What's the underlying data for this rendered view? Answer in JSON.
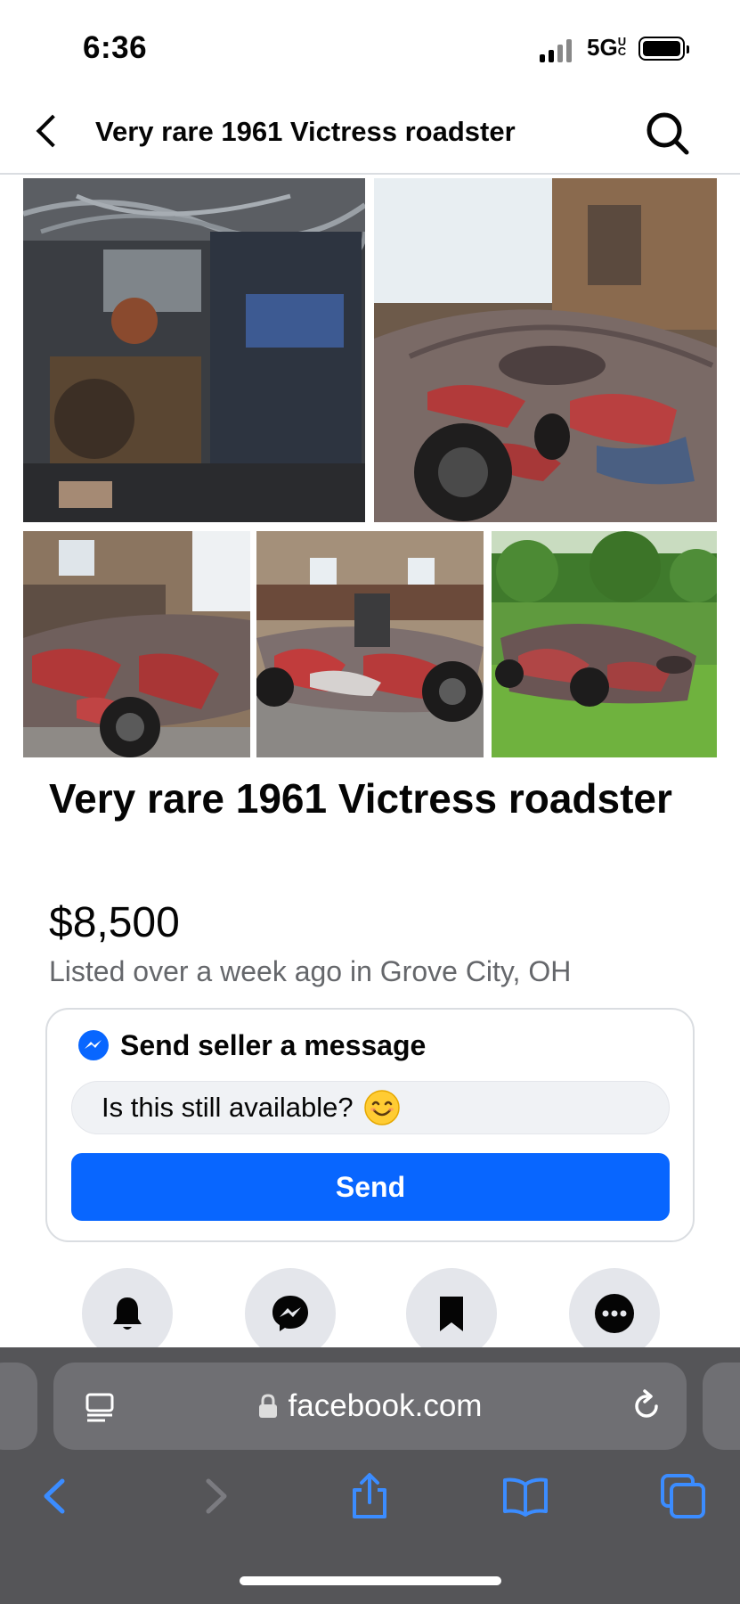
{
  "status_bar": {
    "time": "6:36",
    "network": "5G",
    "network_badge": "UC"
  },
  "header": {
    "title": "Very rare 1961 Victress roadster",
    "back_icon": "chevron-left-icon",
    "search_icon": "search-icon"
  },
  "photos": [
    {
      "subject": "engine-bay"
    },
    {
      "subject": "roadster-hood-in-garage"
    },
    {
      "subject": "roadster-side-in-garage"
    },
    {
      "subject": "roadster-front-in-garage"
    },
    {
      "subject": "roadster-on-grass"
    }
  ],
  "listing": {
    "title": "Very rare 1961 Victress roadster",
    "price": "$8,500",
    "listed": "Listed over a week ago in Grove City, OH"
  },
  "message": {
    "title": "Send seller a message",
    "input_value": "Is this still available?",
    "send_label": "Send"
  },
  "actions": [
    {
      "icon": "bell-icon"
    },
    {
      "icon": "messenger-icon"
    },
    {
      "icon": "bookmark-icon"
    },
    {
      "icon": "more-icon"
    }
  ],
  "browser": {
    "url": "facebook.com"
  },
  "colors": {
    "accent": "#0866ff",
    "secondary_text": "#65676b",
    "chrome": "#555558",
    "ios_blue": "#3b8cff"
  }
}
